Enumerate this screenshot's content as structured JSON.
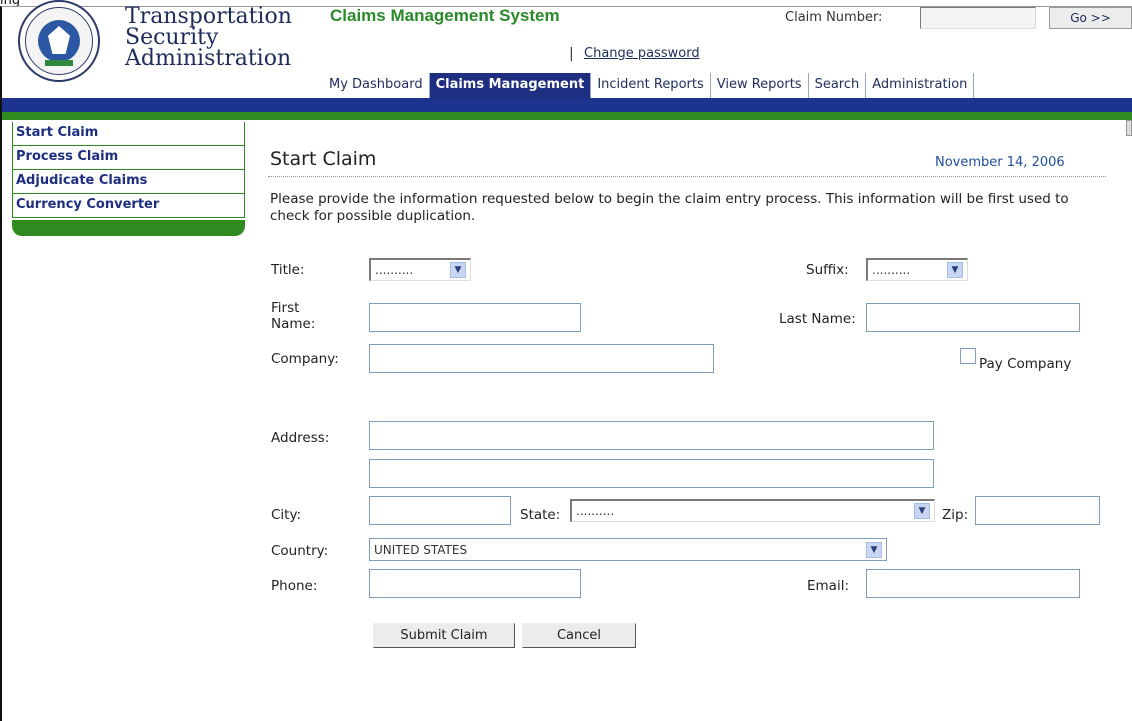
{
  "window": {
    "title": "ing"
  },
  "header": {
    "agency_line1": "Transportation",
    "agency_line2": "Security",
    "agency_line3": "Administration",
    "system_title": "Claims Management System",
    "claim_number_label": "Claim Number:",
    "claim_number_value": "",
    "go_label": "Go >>",
    "separator": "|",
    "change_password": "Change password",
    "brand_colors": {
      "navy": "#1d3390",
      "green": "#2f8a1f"
    }
  },
  "nav": {
    "tabs": [
      {
        "label": "My Dashboard",
        "active": false
      },
      {
        "label": "Claims Management",
        "active": true
      },
      {
        "label": "Incident Reports",
        "active": false
      },
      {
        "label": "View Reports",
        "active": false
      },
      {
        "label": "Search",
        "active": false
      },
      {
        "label": "Administration",
        "active": false
      }
    ]
  },
  "sidebar": {
    "items": [
      {
        "label": "Start Claim"
      },
      {
        "label": "Process Claim"
      },
      {
        "label": "Adjudicate Claims"
      },
      {
        "label": "Currency Converter"
      }
    ]
  },
  "main": {
    "title": "Start Claim",
    "date": "November 14, 2006",
    "intro": "Please provide the information requested below to begin the claim entry process. This information will be first used to check for possible duplication.",
    "form": {
      "title_label": "Title:",
      "title_value": "..........",
      "suffix_label": "Suffix:",
      "suffix_value": "..........",
      "first_name_label_1": "First",
      "first_name_label_2": "Name:",
      "first_name_value": "",
      "last_name_label": "Last Name:",
      "last_name_value": "",
      "company_label": "Company:",
      "company_value": "",
      "pay_company_label": "Pay Company",
      "pay_company_checked": false,
      "address_label": "Address:",
      "address_line1": "",
      "address_line2": "",
      "city_label": "City:",
      "city_value": "",
      "state_label": "State:",
      "state_value": "..........",
      "zip_label": "Zip:",
      "zip_value": "",
      "country_label": "Country:",
      "country_value": "UNITED STATES",
      "phone_label": "Phone:",
      "phone_value": "",
      "email_label": "Email:",
      "email_value": "",
      "submit_label": "Submit Claim",
      "cancel_label": "Cancel"
    }
  },
  "icons": {
    "dropdown": "chevron-down-icon",
    "seal": "dhs-seal-icon"
  }
}
